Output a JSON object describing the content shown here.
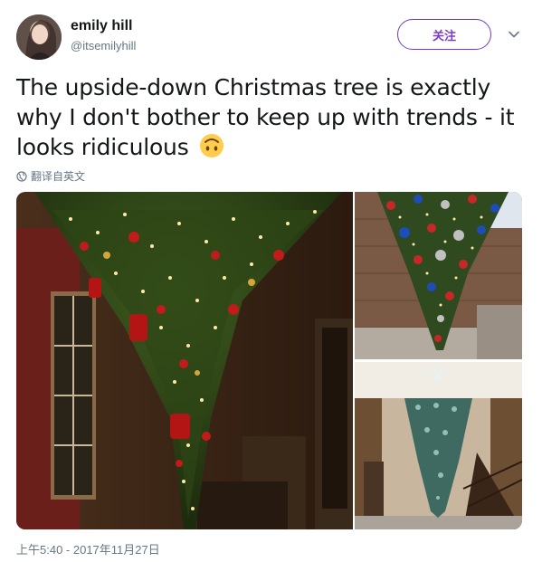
{
  "author": {
    "name": "emily hill",
    "handle": "@itsemilyhill"
  },
  "follow_label": "关注",
  "tweet": {
    "text": "The upside-down Christmas tree is exactly why I don't bother to keep up with trends - it looks ridiculous",
    "emoji": "upside-down-face"
  },
  "translate_label": "翻译自英文",
  "timestamp": "上午5:40 - 2017年11月27日",
  "colors": {
    "follow_accent": "#7b3cc7",
    "muted": "#657786",
    "text": "#14171a"
  },
  "icons": {
    "globe": "globe-icon",
    "caret": "chevron-down-icon",
    "emoji": "upside-down-face-emoji"
  }
}
